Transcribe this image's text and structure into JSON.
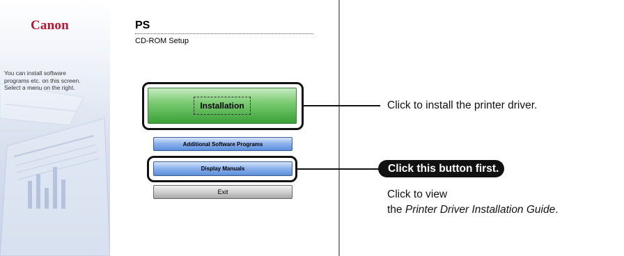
{
  "brand": {
    "logo_text": "Canon"
  },
  "side_panel": {
    "description": "You can install software programs etc. on this screen. Select a menu on the right."
  },
  "header": {
    "title": "PS",
    "subtitle": "CD-ROM Setup"
  },
  "buttons": {
    "installation": "Installation",
    "additional_software": "Additional Software Programs",
    "display_manuals": "Display Manuals",
    "exit": "Exit"
  },
  "callouts": {
    "install_note": "Click to install the printer driver.",
    "first_badge": "Click this button first.",
    "view_line1": "Click to view",
    "view_line2_prefix": "the ",
    "view_line2_title": "Printer Driver Installation Guide",
    "view_line2_suffix": "."
  },
  "colors": {
    "brand_red": "#c8102e",
    "install_green": "#3aa138",
    "button_blue": "#5a8fdc",
    "highlight_black": "#111111"
  }
}
